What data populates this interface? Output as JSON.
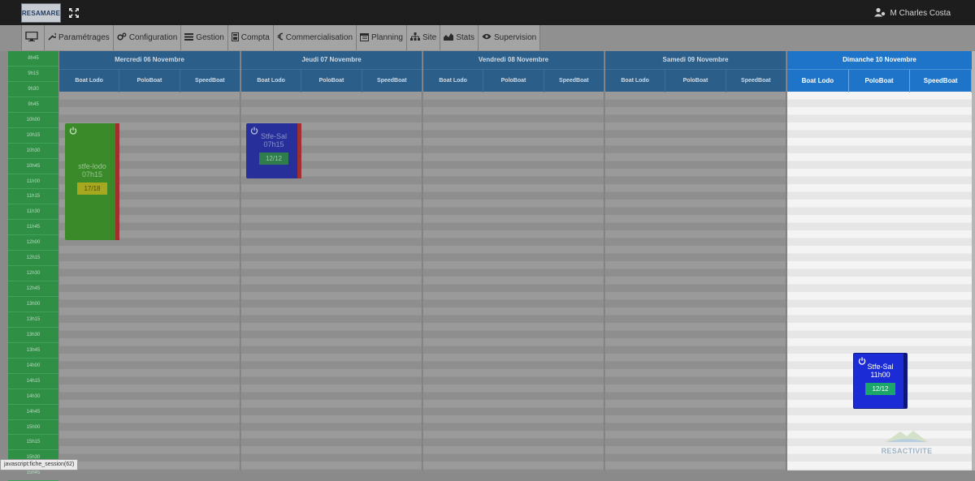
{
  "header": {
    "logo_text": "RESAMARE",
    "user_name": "M Charles Costa"
  },
  "menu": [
    {
      "label": "",
      "icon": "monitor-icon"
    },
    {
      "label": "Paramétrages",
      "icon": "wrench-icon"
    },
    {
      "label": "Configuration",
      "icon": "cogs-icon"
    },
    {
      "label": "Gestion",
      "icon": "list-icon"
    },
    {
      "label": "Compta",
      "icon": "calculator-icon"
    },
    {
      "label": "Commercialisation",
      "icon": "euro-icon"
    },
    {
      "label": "Planning",
      "icon": "calendar-icon"
    },
    {
      "label": "Site",
      "icon": "sitemap-icon"
    },
    {
      "label": "Stats",
      "icon": "chart-icon"
    },
    {
      "label": "Supervision",
      "icon": "eye-icon"
    }
  ],
  "time_slots": [
    "8h45",
    "9h15",
    "9h30",
    "9h45",
    "10h00",
    "10h15",
    "10h30",
    "10h45",
    "11h00",
    "11h15",
    "11h30",
    "11h45",
    "12h00",
    "12h15",
    "12h30",
    "12h45",
    "13h00",
    "13h15",
    "13h30",
    "13h45",
    "14h00",
    "14h15",
    "14h30",
    "14h45",
    "15h00",
    "15h15",
    "15h30",
    "15h45"
  ],
  "days": [
    {
      "title": "Mercredi 06 Novembre",
      "resources": [
        "Boat Lodo",
        "PoloBoat",
        "SpeedBoat"
      ]
    },
    {
      "title": "Jeudi 07 Novembre",
      "resources": [
        "Boat Lodo",
        "PoloBoat",
        "SpeedBoat"
      ]
    },
    {
      "title": "Vendredi 08 Novembre",
      "resources": [
        "Boat Lodo",
        "PoloBoat",
        "SpeedBoat"
      ]
    },
    {
      "title": "Samedi 09 Novembre",
      "resources": [
        "Boat Lodo",
        "PoloBoat",
        "SpeedBoat"
      ]
    },
    {
      "title": "Dimanche 10 Novembre",
      "resources": [
        "Boat Lodo",
        "PoloBoat",
        "SpeedBoat"
      ]
    }
  ],
  "bookings": [
    {
      "name": "stfe-lodo",
      "time": "07h15",
      "count": "17/18",
      "color": "#3a8a2a"
    },
    {
      "name": "Stfe-Sal",
      "time": "07h15",
      "count": "12/12",
      "color": "#27309a"
    },
    {
      "name": "Stfe-Sal",
      "time": "11h00",
      "count": "12/12",
      "color": "#1b2cd6"
    }
  ],
  "status_bar": "javascript:fiche_session(62)",
  "watermark": "RESACTIVITE",
  "colors": {
    "accent": "#1d74c9",
    "time_column": "#2f8f45"
  }
}
